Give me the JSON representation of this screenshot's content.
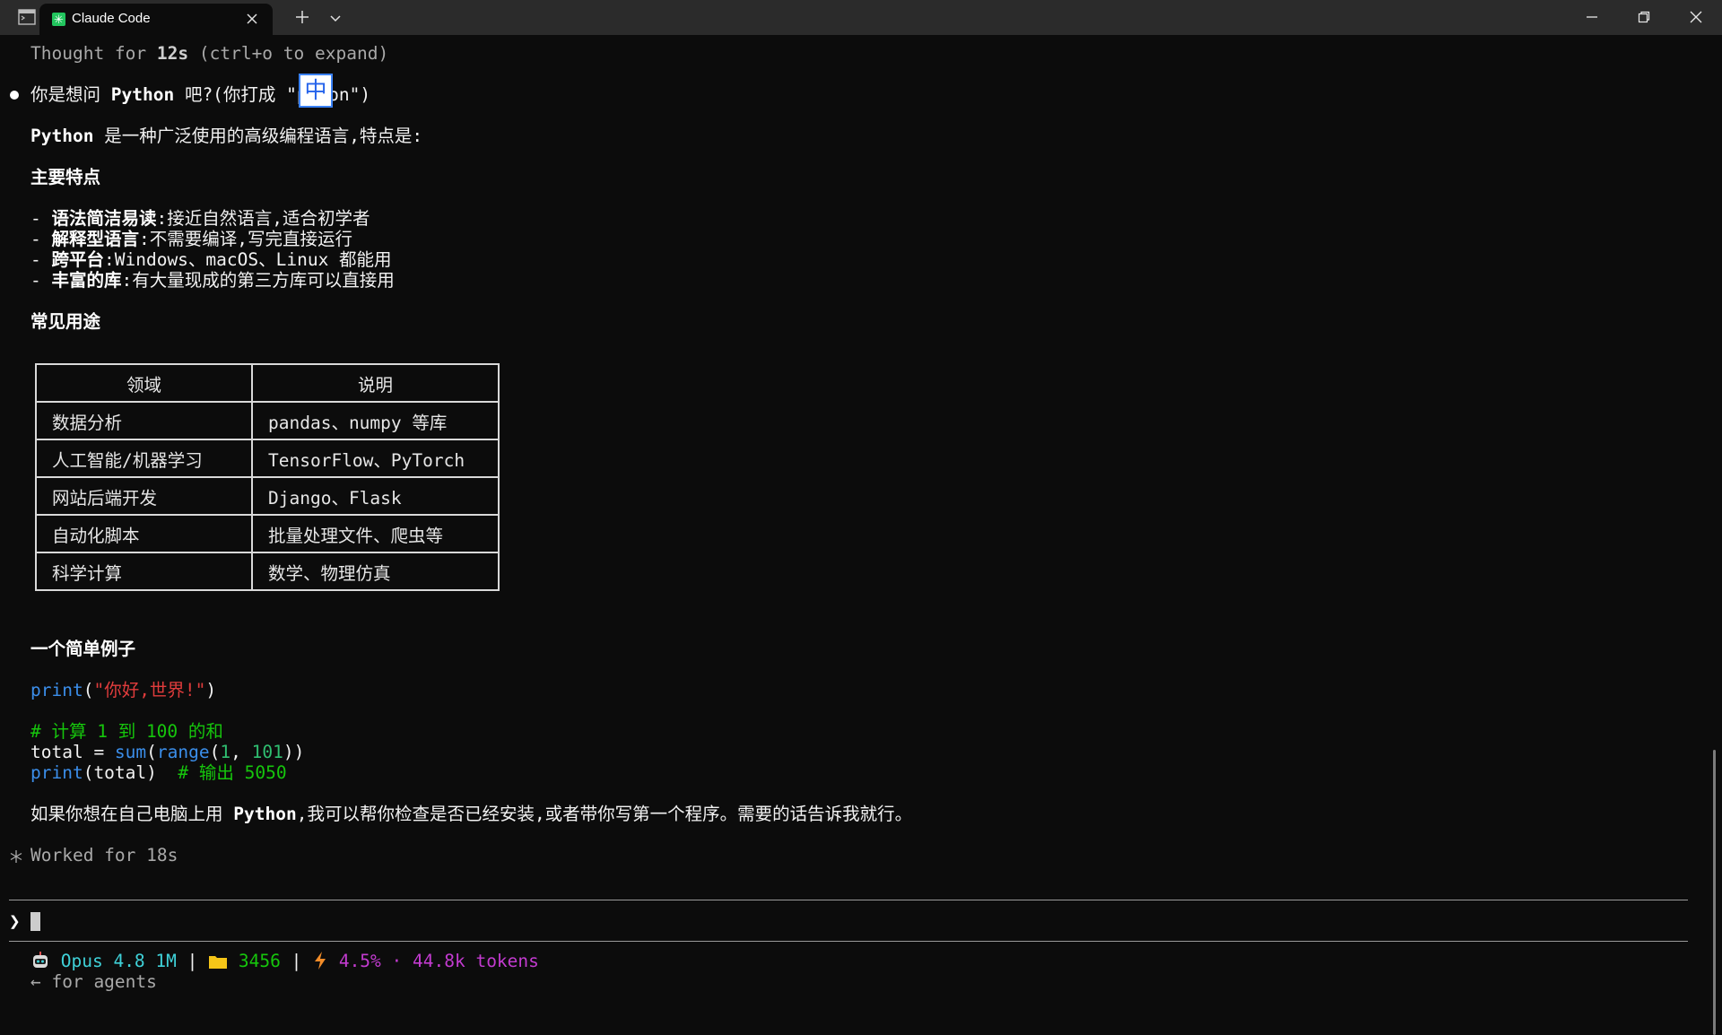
{
  "window": {
    "tab_title": "Claude Code",
    "tab_icon": "claude-asterisk-icon"
  },
  "ime_indicator": "中",
  "transcript": {
    "thought": {
      "prefix": "Thought for ",
      "duration": "12s",
      "hint": " (ctrl+o to expand)"
    },
    "reply_line1_a": "你是想问 ",
    "reply_line1_b": "Python",
    "reply_line1_c": " 吧?(你打成 ",
    "reply_line1_d": "\"pyhon\")",
    "intro_a": "Python",
    "intro_b": " 是一种广泛使用的高级编程语言,特点是:",
    "features_heading": "主要特点",
    "features": [
      {
        "name": "语法简洁易读",
        "desc": ":接近自然语言,适合初学者"
      },
      {
        "name": "解释型语言",
        "desc": ":不需要编译,写完直接运行"
      },
      {
        "name": "跨平台",
        "desc": ":Windows、macOS、Linux 都能用"
      },
      {
        "name": "丰富的库",
        "desc": ":有大量现成的第三方库可以直接用"
      }
    ],
    "uses_heading": "常见用途",
    "uses_table": {
      "headers": [
        "领域",
        "说明"
      ],
      "rows": [
        [
          "数据分析",
          "pandas、numpy 等库"
        ],
        [
          "人工智能/机器学习",
          "TensorFlow、PyTorch"
        ],
        [
          "网站后端开发",
          "Django、Flask"
        ],
        [
          "自动化脚本",
          "批量处理文件、爬虫等"
        ],
        [
          "科学计算",
          "数学、物理仿真"
        ]
      ]
    },
    "example_heading": "一个简单例子",
    "code": {
      "l1_fn": "print",
      "l1_open": "(",
      "l1_str": "\"你好,世界!\"",
      "l1_close": ")",
      "l2_comment": "# 计算 1 到 100 的和",
      "l3_var": "total = ",
      "l3_sum": "sum",
      "l3_paren": "(",
      "l3_range": "range",
      "l3_paren2": "(",
      "l3_n1": "1",
      "l3_comma": ", ",
      "l3_n2": "101",
      "l3_close": "))",
      "l4_fn": "print",
      "l4_args": "(total)  ",
      "l4_comment": "# 输出 5050"
    },
    "closing_a": "如果你想在自己电脑上用 ",
    "closing_b": "Python",
    "closing_c": ",我可以帮你检查是否已经安装,或者带你写第一个程序。需要的话告诉我就行。",
    "worked": "Worked for 18s"
  },
  "prompt": {
    "symbol": "❯",
    "value": ""
  },
  "statusline": {
    "model": "Opus 4.8 1M",
    "sep": " | ",
    "folder": "3456",
    "usage": "4.5% · 44.8k tokens",
    "agents_hint": "← for agents",
    "model_icon": "robot-icon",
    "folder_icon": "folder-icon",
    "usage_icon": "lightning-icon",
    "colors": {
      "model": "#3fd1d8",
      "folder": "#16c60c",
      "usage": "#c33bd0"
    }
  }
}
